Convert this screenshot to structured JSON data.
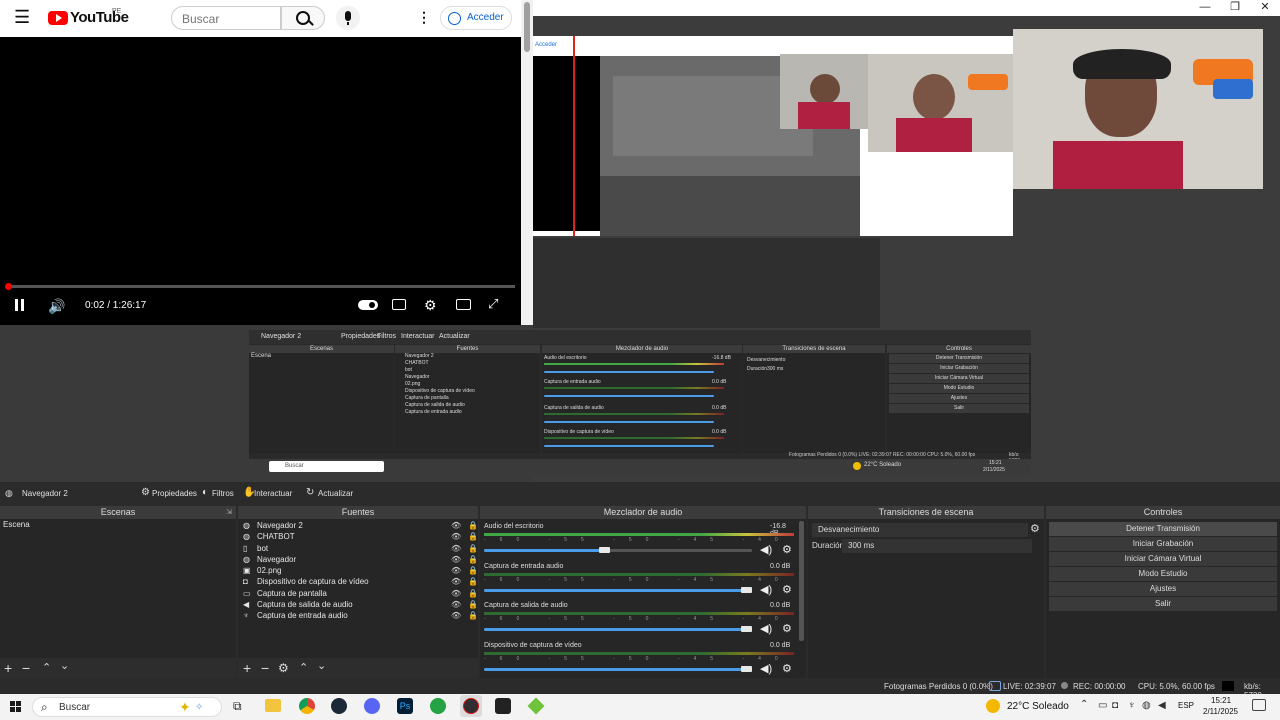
{
  "youtube": {
    "logo": "YouTube",
    "region": "PE",
    "search_placeholder": "Buscar",
    "signin": "Acceder",
    "time": "0:02 / 1:26:17",
    "progress_fraction": 0.0004
  },
  "window": {
    "minimize": "—",
    "restore": "❐",
    "close": "✕"
  },
  "nested": {
    "scene_name": "Navegador 2",
    "properties": "Propiedades",
    "filters": "Filtros",
    "interact": "Interactuar",
    "refresh": "Actualizar",
    "headers": [
      "Escenas",
      "Fuentes",
      "Mezclador de audio",
      "Transiciones de escena",
      "Controles"
    ],
    "scene": "Escena",
    "sources": [
      "Navegador 2",
      "CHATBOT",
      "bot",
      "Navegador",
      "02.png",
      "Dispositivo de captura de vídeo",
      "Captura de pantalla",
      "Captura de salida de audio",
      "Captura de entrada audio"
    ],
    "mixer": [
      "Audio del escritorio",
      "Captura de entrada audio",
      "Captura de salida de audio",
      "Dispositivo de captura de vídeo"
    ],
    "mixer_db": [
      "-16.8 dB",
      "0.0 dB",
      "0.0 dB",
      "0.0 dB"
    ],
    "transition": "Desvanecimiento",
    "duration_label": "Duración",
    "duration": "300 ms",
    "controls": [
      "Detener Transmisión",
      "Iniciar Grabación",
      "Iniciar Cámara Virtual",
      "Modo Estudio",
      "Ajustes",
      "Salir"
    ],
    "status": "Fotogramas Perdidos 0 (0.0%)  LIVE: 02:39:07  REC: 00:00:00  CPU: 5.0%, 60.00 fps",
    "kbs": "kb/s: 5720",
    "task_search": "Buscar",
    "weather": "22°C  Soleado",
    "clock_time": "15:21",
    "clock_date": "2/11/2025"
  },
  "obs": {
    "scene_name": "Navegador 2",
    "toolbar": {
      "properties": "Propiedades",
      "filters": "Filtros",
      "interact": "Interactuar",
      "refresh": "Actualizar"
    },
    "panels": {
      "scenes": "Escenas",
      "sources": "Fuentes",
      "mixer": "Mezclador de audio",
      "transitions": "Transiciones de escena",
      "controls": "Controles"
    },
    "scenes": [
      "Escena"
    ],
    "sources": [
      {
        "label": "Navegador 2",
        "icon": "globe-icon"
      },
      {
        "label": "CHATBOT",
        "icon": "globe-icon"
      },
      {
        "label": "bot",
        "icon": "text-icon"
      },
      {
        "label": "Navegador",
        "icon": "globe-icon"
      },
      {
        "label": "02.png",
        "icon": "image-icon"
      },
      {
        "label": "Dispositivo de captura de vídeo",
        "icon": "camera-icon"
      },
      {
        "label": "Captura de pantalla",
        "icon": "monitor-icon"
      },
      {
        "label": "Captura de salida de audio",
        "icon": "speaker-icon"
      },
      {
        "label": "Captura de entrada audio",
        "icon": "mic-icon"
      }
    ],
    "mixer": [
      {
        "name": "Audio del escritorio",
        "db": "-16.8 dB",
        "volume": 0.47
      },
      {
        "name": "Captura de entrada audio",
        "db": "0.0 dB",
        "volume": 1.0
      },
      {
        "name": "Captura de salida de audio",
        "db": "0.0 dB",
        "volume": 1.0
      },
      {
        "name": "Dispositivo de captura de vídeo",
        "db": "0.0 dB",
        "volume": 1.0
      }
    ],
    "meter_ticks": "-60 -55 -50 -45 -40 -35 -30 -25 -20 -15 -10 -5 0",
    "transition": {
      "value": "Desvanecimiento",
      "duration_label": "Duración",
      "duration": "300 ms"
    },
    "controls": [
      "Detener Transmisión",
      "Iniciar Grabación",
      "Iniciar Cámara Virtual",
      "Modo Estudio",
      "Ajustes",
      "Salir"
    ],
    "status": {
      "dropped": "Fotogramas Perdidos 0 (0.0%)",
      "live": "LIVE: 02:39:07",
      "rec": "REC: 00:00:00",
      "cpu": "CPU: 5.0%, 60.00 fps",
      "kbs": "kb/s: 5720"
    }
  },
  "taskbar": {
    "search": "Buscar",
    "weather": "22°C  Soleado",
    "lang": "ESP",
    "time": "15:21",
    "date": "2/11/2025"
  },
  "colors": {
    "accent": "#4a9ce8",
    "youtube_red": "#ff0000",
    "obs_bg": "#2b2b2b"
  }
}
